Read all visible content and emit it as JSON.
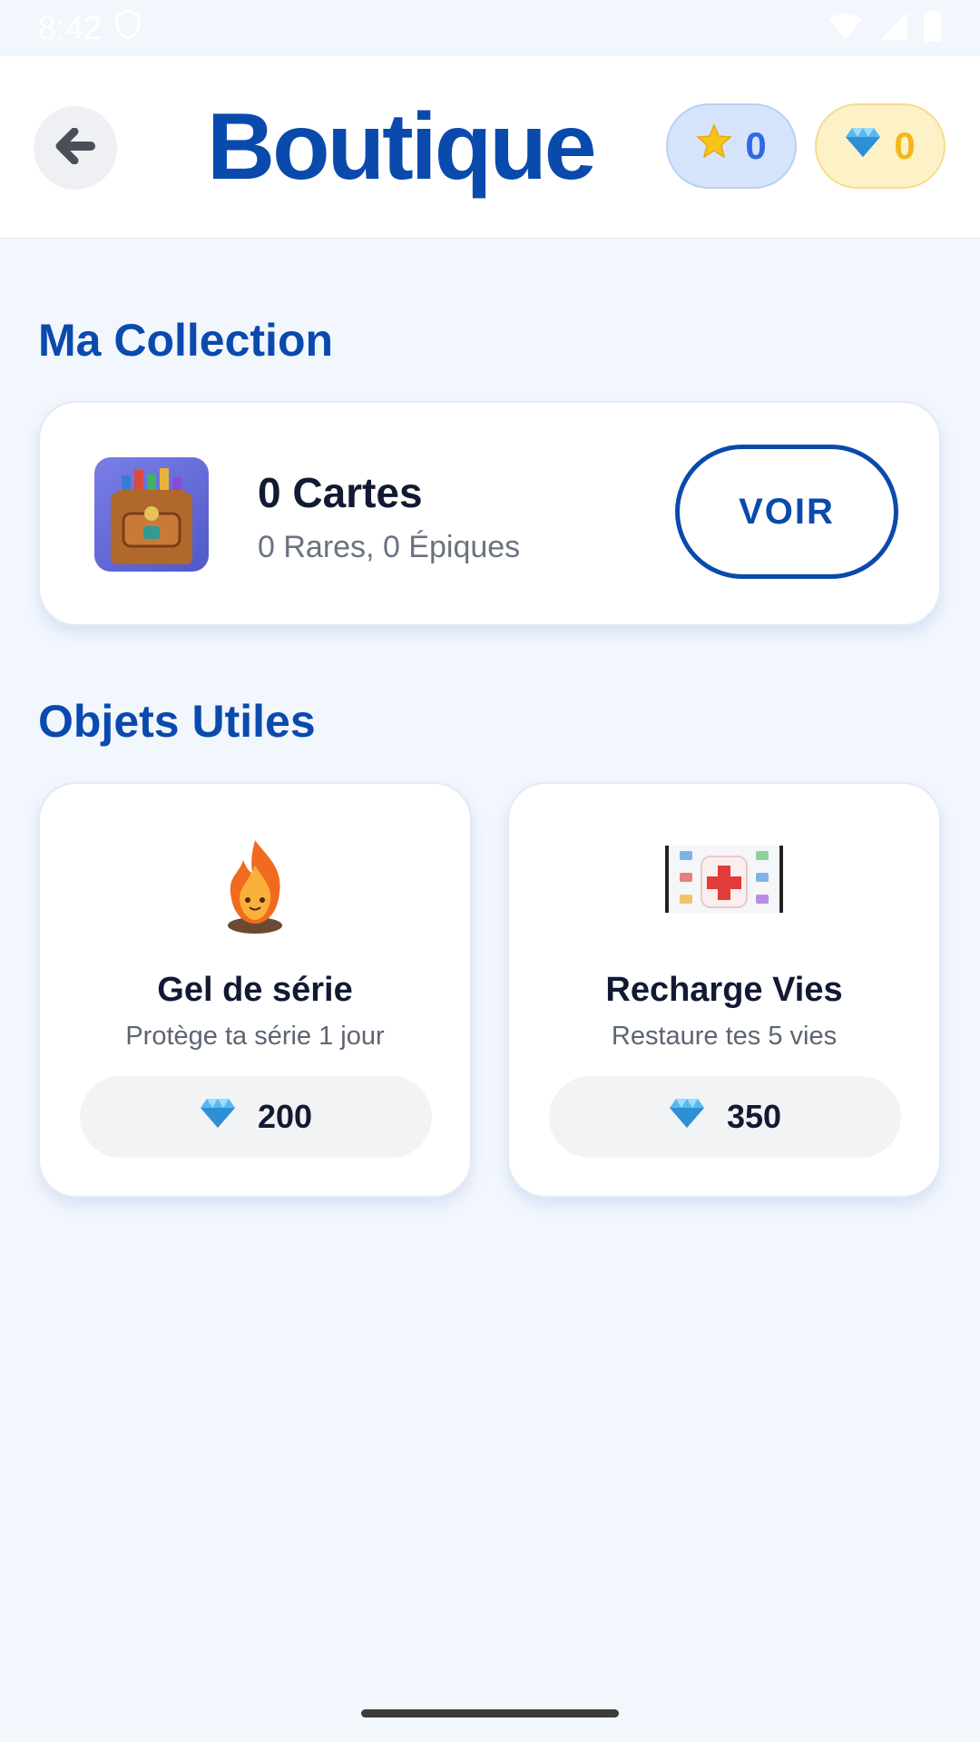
{
  "status_bar": {
    "time": "8:42",
    "shield_icon": "shield-icon",
    "wifi_icon": "wifi-icon",
    "signal_icon": "signal-icon",
    "battery_icon": "battery-icon"
  },
  "header": {
    "title": "Boutique",
    "back_icon": "arrow-left-icon",
    "stars": {
      "icon": "star-icon",
      "value": "0"
    },
    "gems": {
      "icon": "gem-icon",
      "value": "0"
    }
  },
  "collection": {
    "section_title": "Ma Collection",
    "card_count": "0 Cartes",
    "card_detail": "0 Rares, 0 Épiques",
    "view_button": "VOIR",
    "image_icon": "backpack-icon"
  },
  "utilities": {
    "section_title": "Objets Utiles",
    "items": [
      {
        "name": "Gel de série",
        "description": "Protège ta série 1 jour",
        "price": "200",
        "icon": "flame-icon",
        "currency_icon": "gem-icon"
      },
      {
        "name": "Recharge Vies",
        "description": "Restaure tes 5 vies",
        "price": "350",
        "icon": "health-kit-icon",
        "currency_icon": "gem-icon"
      }
    ]
  },
  "colors": {
    "accent": "#0a4aad",
    "background": "#f2f6fd",
    "star_pill": "#d6e4fb",
    "gem_pill": "#fdf1c8"
  }
}
